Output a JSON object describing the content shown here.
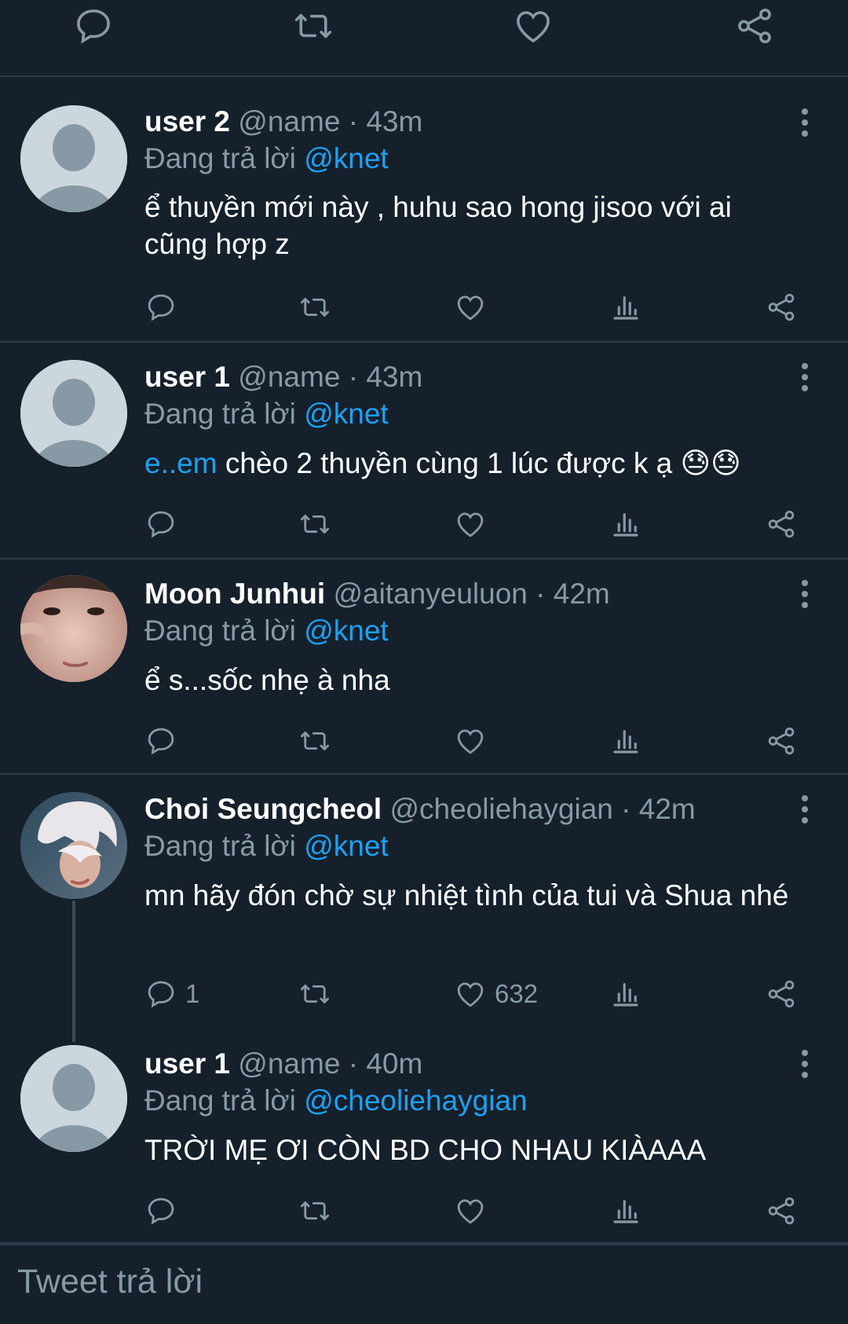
{
  "top_actions": {
    "icons": [
      "reply-icon",
      "retweet-icon",
      "like-icon",
      "share-icon"
    ]
  },
  "tweets": [
    {
      "display_name": "user 2",
      "handle": "@name",
      "separator": "·",
      "time": "43m",
      "replying_prefix": "Đang trả lời",
      "replying_to": "@knet",
      "text": "ể thuyền mới này , huhu sao hong jisoo với ai cũng hợp z",
      "reply_count": "",
      "like_count": ""
    },
    {
      "display_name": "user 1",
      "handle": "@name",
      "separator": "·",
      "time": "43m",
      "replying_prefix": "Đang trả lời",
      "replying_to": "@knet",
      "text_link": "e..em",
      "text": " chèo 2 thuyền cùng 1 lúc được k ạ",
      "emoji": "😓😓",
      "reply_count": "",
      "like_count": ""
    },
    {
      "display_name": "Moon Junhui",
      "handle": "@aitanyeuluon",
      "separator": "·",
      "time": "42m",
      "replying_prefix": "Đang trả lời",
      "replying_to": "@knet",
      "text": "ể s...sốc nhẹ à nha",
      "reply_count": "",
      "like_count": ""
    },
    {
      "display_name": "Choi Seungcheol",
      "handle": "@cheoliehaygian",
      "separator": "·",
      "time": "42m",
      "replying_prefix": "Đang trả lời",
      "replying_to": "@knet",
      "text": "mn hãy đón chờ sự nhiệt tình của tui và Shua nhé",
      "reply_count": "1",
      "like_count": "632"
    },
    {
      "display_name": "user 1",
      "handle": "@name",
      "separator": "·",
      "time": "40m",
      "replying_prefix": "Đang trả lời",
      "replying_to": "@cheoliehaygian",
      "text": "TRỜI MẸ ƠI CÒN BD CHO NHAU KIÀAAA",
      "reply_count": "",
      "like_count": ""
    }
  ],
  "reply_box": {
    "placeholder": "Tweet trả lời"
  },
  "colors": {
    "background": "#15202b",
    "secondary_text": "#8899a6",
    "link": "#1da1f2",
    "divider": "#2f3b47"
  }
}
